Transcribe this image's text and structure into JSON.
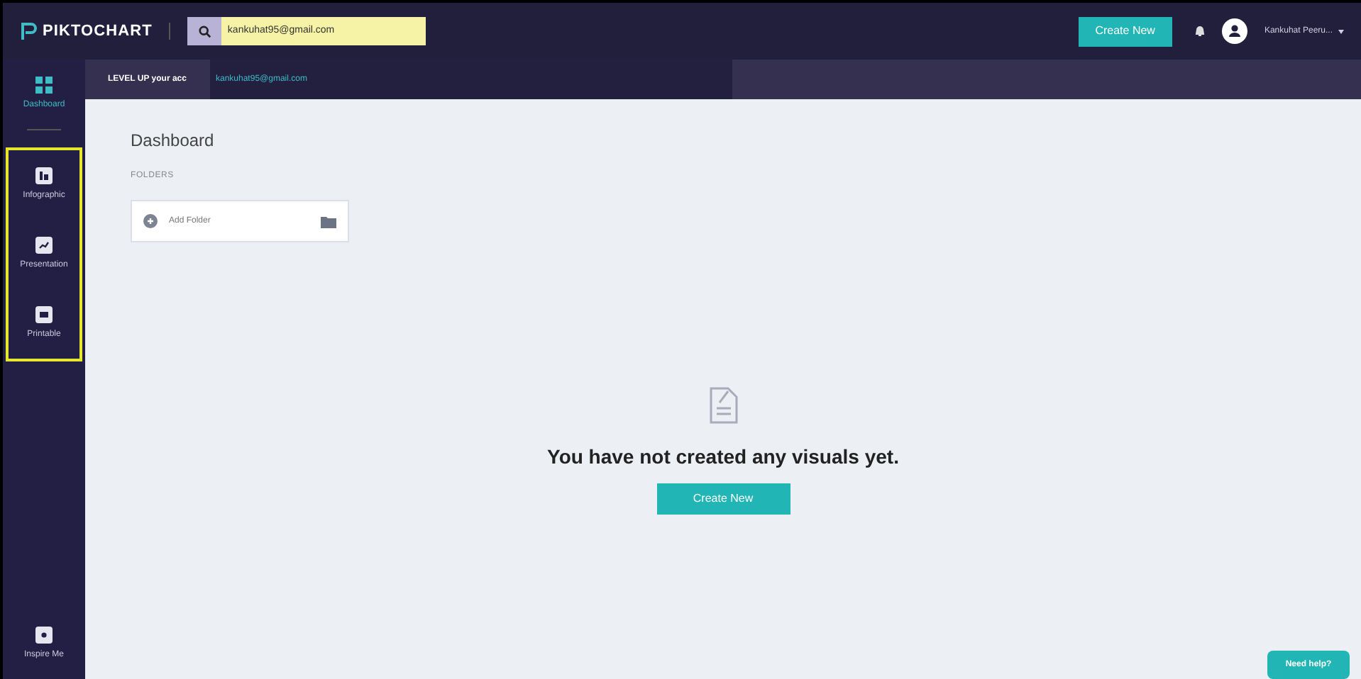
{
  "header": {
    "logo": "PIKTOCHART",
    "search": {
      "value": "kankuhat95@gmail.com"
    },
    "create_button": "Create New",
    "user_name": "Kankuhat Peeru..."
  },
  "banner": {
    "text": "LEVEL UP your acc",
    "suggestion": "kankuhat95@gmail.com"
  },
  "sidebar": {
    "top_item": {
      "label": "Dashboard",
      "selected": true
    },
    "highlighted_items": [
      {
        "label": "Infographic",
        "selected": false,
        "kind": "infographic"
      },
      {
        "label": "Presentation",
        "selected": false,
        "kind": "presentation"
      },
      {
        "label": "Printable",
        "selected": false,
        "kind": "printable"
      }
    ],
    "bottom_item": {
      "label": "Inspire Me",
      "selected": false
    }
  },
  "main": {
    "title": "Dashboard",
    "section_label": "FOLDERS",
    "add_folder": "Add Folder",
    "empty_message": "You have not created any visuals yet.",
    "create_button": "Create New"
  },
  "help_button": "Need help?"
}
